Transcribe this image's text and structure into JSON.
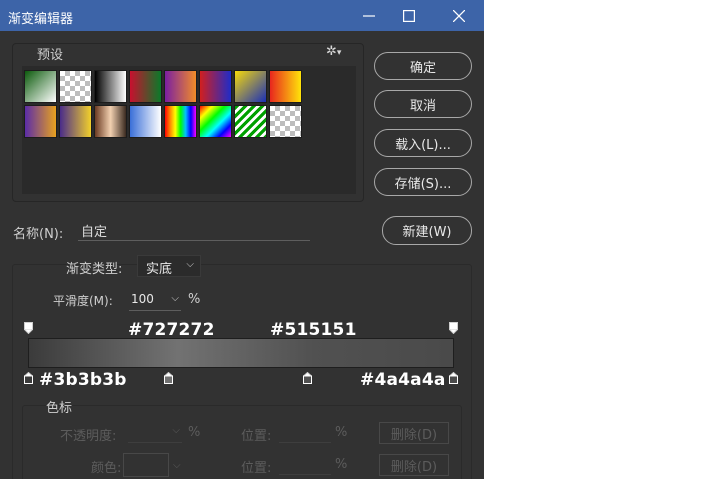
{
  "window": {
    "title": "渐变编辑器",
    "controls": {
      "minimize_icon": "minimize-icon",
      "maximize_icon": "maximize-icon",
      "close_icon": "close-icon"
    }
  },
  "presets": {
    "label": "预设",
    "gear_icon": "gear-icon",
    "swatches": [
      "linear-gradient(135deg,#0c5a0c,#ffffff)",
      "repeating-conic-gradient(#bdbdbd 0% 25%, #ffffff 0% 50%) 0 0/10px 10px",
      "linear-gradient(to right,#000000,#ffffff)",
      "linear-gradient(to right,#c8102e,#0a7a2a)",
      "linear-gradient(to right,#7a1fa2,#f28c28)",
      "linear-gradient(to right,#d11f1f,#1f2cc8)",
      "linear-gradient(135deg,#f5d90a,#1a2fb8)",
      "linear-gradient(to right,#e8261e,#ffe40a)",
      "linear-gradient(to right,#5b2ca8,#e8a21f)",
      "linear-gradient(to right,#4a2c8a,#f2d02b)",
      "linear-gradient(to right,#6a3a22,#f2d0b0,#3a2a20)",
      "linear-gradient(to right,#3a6fd8,#ffffff)",
      "linear-gradient(to right,#ff0000,#ff8800,#ffff00,#00ff00,#00bfff,#0000ff,#ff00ff)",
      "linear-gradient(135deg,#ff0000,#ffff00,#00ff00,#00ffff,#0000ff,#ff00ff)",
      "repeating-linear-gradient(135deg,#00a000 0 3px,#ffffff 3px 6px)",
      "repeating-conic-gradient(#bdbdbd 0% 25%, #ffffff 0% 50%) 0 0/10px 10px"
    ]
  },
  "buttons": {
    "ok": "确定",
    "cancel": "取消",
    "load": "载入(L)...",
    "save": "存储(S)...",
    "new": "新建(W)"
  },
  "name": {
    "label": "名称(N):",
    "value": "自定"
  },
  "gradient_type": {
    "label": "渐变类型:",
    "value": "实底"
  },
  "smoothness": {
    "label": "平滑度(M):",
    "value": "100",
    "unit": "%"
  },
  "annotations": {
    "top_center": "#727272",
    "top_right": "#515151",
    "bottom_left": "#3b3b3b",
    "bottom_right": "#4a4a4a"
  },
  "stops": {
    "group_label": "色标",
    "opacity_label": "不透明度:",
    "opacity_unit": "%",
    "position_label_1": "位置:",
    "position_unit_1": "%",
    "delete_1": "删除(D)",
    "color_label": "颜色:",
    "position_label_2": "位置:",
    "position_unit_2": "%",
    "delete_2": "删除(D)"
  },
  "colors": {
    "titlebar": "#3d64a8",
    "dialog_bg": "#323232"
  }
}
